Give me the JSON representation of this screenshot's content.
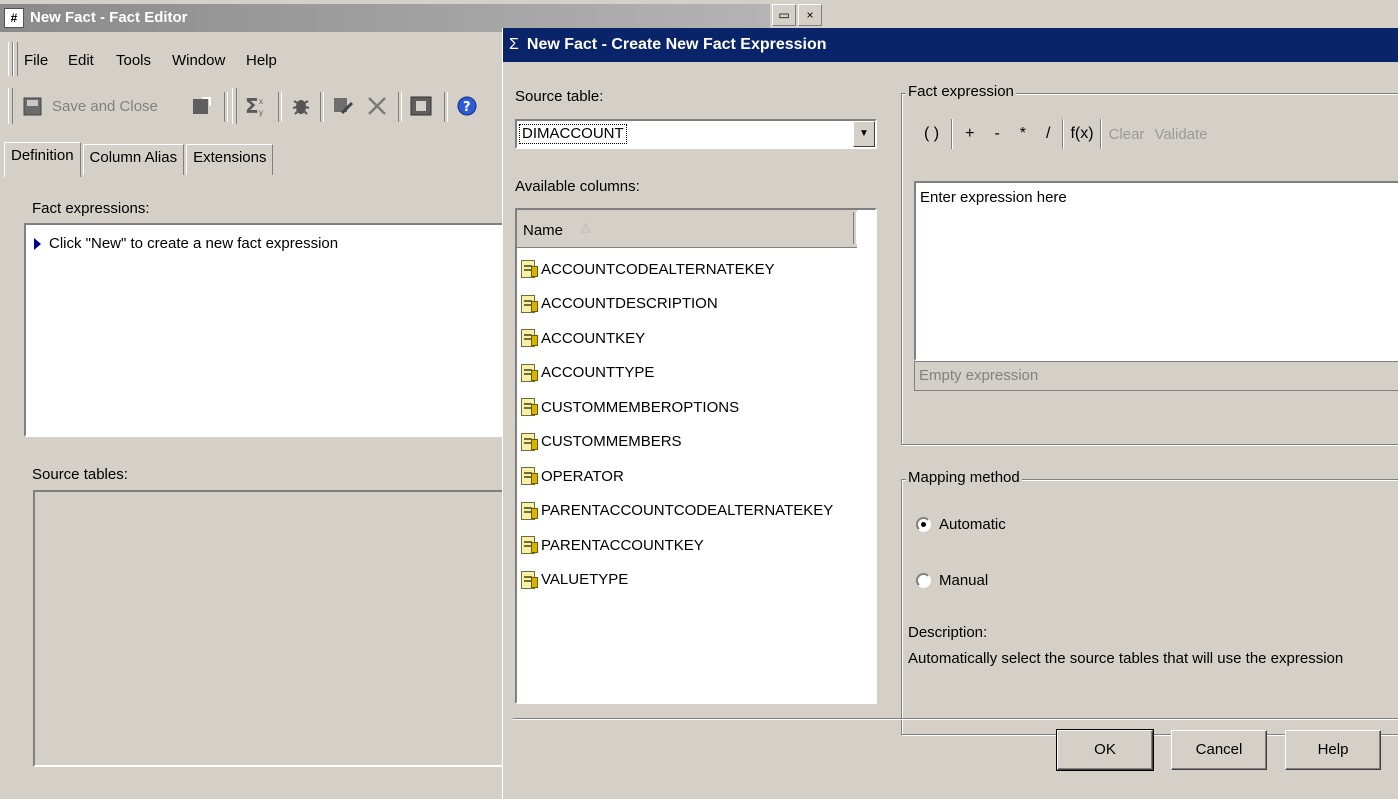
{
  "editor": {
    "title": "New Fact - Fact Editor",
    "app_icon": "#",
    "title_buttons": [
      "▭",
      "×"
    ],
    "menu": [
      "File",
      "Edit",
      "Tools",
      "Window",
      "Help"
    ],
    "toolbar": {
      "save_close_label": "Save and Close"
    },
    "tabs": [
      "Definition",
      "Column Alias",
      "Extensions"
    ],
    "fact_expressions_label": "Fact expressions:",
    "fact_expressions_hint": "Click \"New\" to create a new fact expression",
    "source_tables_label": "Source tables:"
  },
  "dialog": {
    "title": "New Fact - Create New Fact Expression",
    "title_icon": "Σ",
    "source_table_label": "Source table:",
    "source_table_value": "DIMACCOUNT",
    "available_columns_label": "Available columns:",
    "columns_header": "Name",
    "columns_sort_glyph": "△",
    "columns": [
      "ACCOUNTCODEALTERNATEKEY",
      "ACCOUNTDESCRIPTION",
      "ACCOUNTKEY",
      "ACCOUNTTYPE",
      "CUSTOMMEMBEROPTIONS",
      "CUSTOMMEMBERS",
      "OPERATOR",
      "PARENTACCOUNTCODEALTERNATEKEY",
      "PARENTACCOUNTKEY",
      "VALUETYPE"
    ],
    "fact_expression_label": "Fact expression",
    "expr_toolbar": [
      "( )",
      "+",
      "-",
      "*",
      "/",
      "f(x)"
    ],
    "expr_clear": "Clear",
    "expr_validate": "Validate",
    "expr_placeholder": "Enter expression here",
    "expr_status": "Empty expression",
    "mapping_label": "Mapping method",
    "mapping_options": [
      "Automatic",
      "Manual"
    ],
    "mapping_selected": "Automatic",
    "description_label": "Description:",
    "description_text": "Automatically select the source tables that will use the expression",
    "buttons": {
      "ok": "OK",
      "cancel": "Cancel",
      "help": "Help"
    }
  }
}
